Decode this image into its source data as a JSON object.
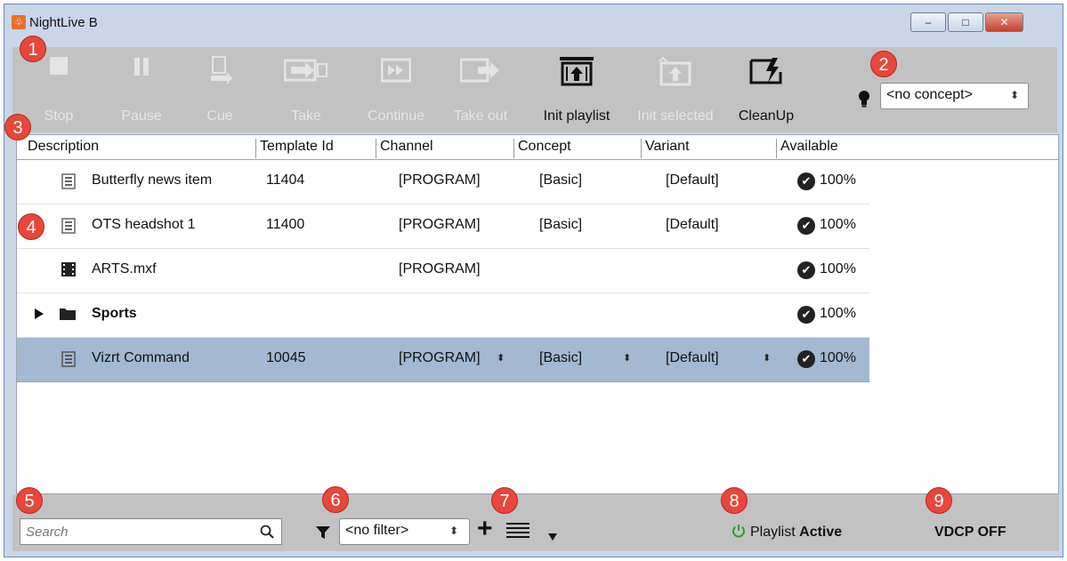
{
  "window": {
    "title": "NightLive B",
    "app_icon_glyph": "♧",
    "minimize_glyph": "–",
    "restore_glyph": "□",
    "close_glyph": "✕"
  },
  "toolbar": {
    "buttons": [
      {
        "label": "Stop",
        "enabled": false,
        "icon": "stop-icon"
      },
      {
        "label": "Pause",
        "enabled": false,
        "icon": "pause-icon"
      },
      {
        "label": "Cue",
        "enabled": false,
        "icon": "cue-icon"
      },
      {
        "label": "Take",
        "enabled": false,
        "icon": "take-icon"
      },
      {
        "label": "Continue",
        "enabled": false,
        "icon": "continue-icon"
      },
      {
        "label": "Take out",
        "enabled": false,
        "icon": "take-out-icon"
      },
      {
        "label": "Init playlist",
        "enabled": true,
        "icon": "init-playlist-icon"
      },
      {
        "label": "Init selected",
        "enabled": false,
        "icon": "init-selected-icon"
      },
      {
        "label": "CleanUp",
        "enabled": true,
        "icon": "cleanup-icon"
      }
    ],
    "concept_select": {
      "value": "<no concept>",
      "icon": "lightbulb-icon"
    }
  },
  "table": {
    "columns": [
      "Description",
      "Template Id",
      "Channel",
      "Concept",
      "Variant",
      "Available"
    ],
    "rows": [
      {
        "description": "Butterfly news item",
        "template_id": "11404",
        "channel": "[PROGRAM]",
        "concept": "[Basic]",
        "variant": "[Default]",
        "available": "100%",
        "type": "template"
      },
      {
        "description": "OTS headshot 1",
        "template_id": "11400",
        "channel": "[PROGRAM]",
        "concept": "[Basic]",
        "variant": "[Default]",
        "available": "100%",
        "type": "template"
      },
      {
        "description": "ARTS.mxf",
        "template_id": "",
        "channel": "[PROGRAM]",
        "concept": "",
        "variant": "",
        "available": "100%",
        "type": "video"
      },
      {
        "description": "Sports",
        "template_id": "",
        "channel": "",
        "concept": "",
        "variant": "",
        "available": "100%",
        "type": "folder"
      },
      {
        "description": "Vizrt Command",
        "template_id": "10045",
        "channel": "[PROGRAM]",
        "concept": "[Basic]",
        "variant": "[Default]",
        "available": "100%",
        "type": "template",
        "selected": true
      }
    ],
    "check_glyph": "✔",
    "spin_glyph": "⬍"
  },
  "status": {
    "search_placeholder": "Search",
    "filter_value": "<no filter>",
    "add_glyph": "+",
    "playlist_label": "Playlist",
    "playlist_state": "Active",
    "vdcp": "VDCP OFF"
  },
  "badges": [
    "1",
    "2",
    "3",
    "4",
    "5",
    "6",
    "7",
    "8",
    "9"
  ],
  "colors": {
    "badge": "#e8473b",
    "selected_row": "#a3b8d2",
    "toolbar": "#c2c2c2",
    "power_green": "#2e9c2e"
  }
}
